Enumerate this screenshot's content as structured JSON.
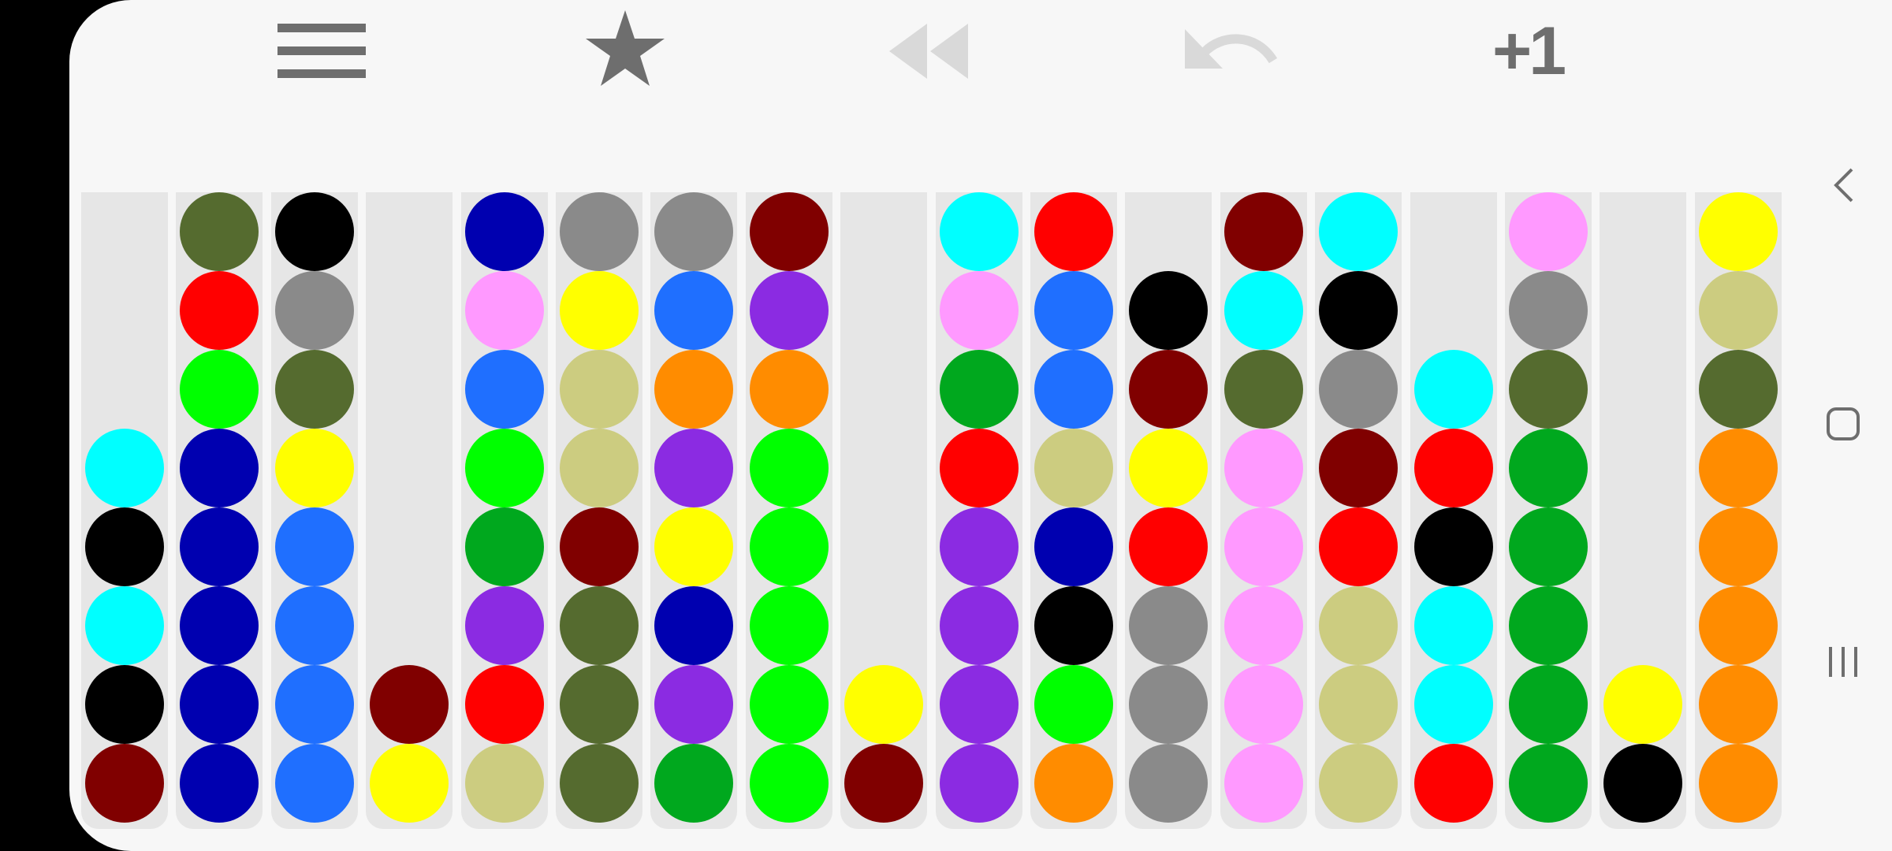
{
  "toolbar": {
    "items": [
      {
        "name": "menu-icon"
      },
      {
        "name": "star-icon"
      },
      {
        "name": "rewind-icon"
      },
      {
        "name": "undo-icon"
      },
      {
        "name": "plus-one-button",
        "label": "+1"
      }
    ]
  },
  "navigation": {
    "items": [
      "back-nav-icon",
      "home-nav-icon",
      "recents-nav-icon"
    ]
  },
  "colors": {
    "k": "#000000",
    "r": "#ff0000",
    "R": "#800000",
    "y": "#ffff00",
    "c": "#00ffff",
    "b": "#0000b0",
    "B": "#1f6fff",
    "l": "#00ff00",
    "g": "#00a81e",
    "o": "#556b2f",
    "G": "#8a8a8a",
    "p": "#ff99ff",
    "v": "#8b2be2",
    "n": "#ff8c00",
    "h": "#cccc80"
  },
  "tubes": [
    {
      "balls": [
        "c",
        "k",
        "c",
        "k",
        "R"
      ]
    },
    {
      "balls": [
        "o",
        "r",
        "l",
        "b",
        "b",
        "b",
        "b",
        "b"
      ]
    },
    {
      "balls": [
        "k",
        "G",
        "o",
        "y",
        "B",
        "B",
        "B",
        "B"
      ]
    },
    {
      "balls": [
        "R",
        "y"
      ]
    },
    {
      "balls": [
        "b",
        "p",
        "B",
        "l",
        "g",
        "v",
        "r",
        "h"
      ]
    },
    {
      "balls": [
        "G",
        "y",
        "h",
        "h",
        "R",
        "o",
        "o",
        "o"
      ]
    },
    {
      "balls": [
        "G",
        "B",
        "n",
        "v",
        "y",
        "b",
        "v",
        "g"
      ]
    },
    {
      "balls": [
        "R",
        "v",
        "n",
        "l",
        "l",
        "l",
        "l",
        "l"
      ]
    },
    {
      "balls": [
        "y",
        "R"
      ]
    },
    {
      "balls": [
        "c",
        "p",
        "g",
        "r",
        "v",
        "v",
        "v",
        "v"
      ]
    },
    {
      "balls": [
        "r",
        "B",
        "B",
        "h",
        "b",
        "k",
        "l",
        "n"
      ]
    },
    {
      "balls": [
        "k",
        "R",
        "y",
        "r",
        "G",
        "G",
        "G"
      ]
    },
    {
      "balls": [
        "R",
        "c",
        "o",
        "p",
        "p",
        "p",
        "p",
        "p"
      ]
    },
    {
      "balls": [
        "c",
        "k",
        "G",
        "R",
        "r",
        "h",
        "h",
        "h"
      ]
    },
    {
      "balls": [
        "c",
        "r",
        "k",
        "c",
        "c",
        "r"
      ]
    },
    {
      "balls": [
        "p",
        "G",
        "o",
        "g",
        "g",
        "g",
        "g",
        "g"
      ]
    },
    {
      "balls": [
        "y",
        "k"
      ]
    },
    {
      "balls": [
        "y",
        "h",
        "o",
        "n",
        "n",
        "n",
        "n",
        "n"
      ]
    }
  ]
}
